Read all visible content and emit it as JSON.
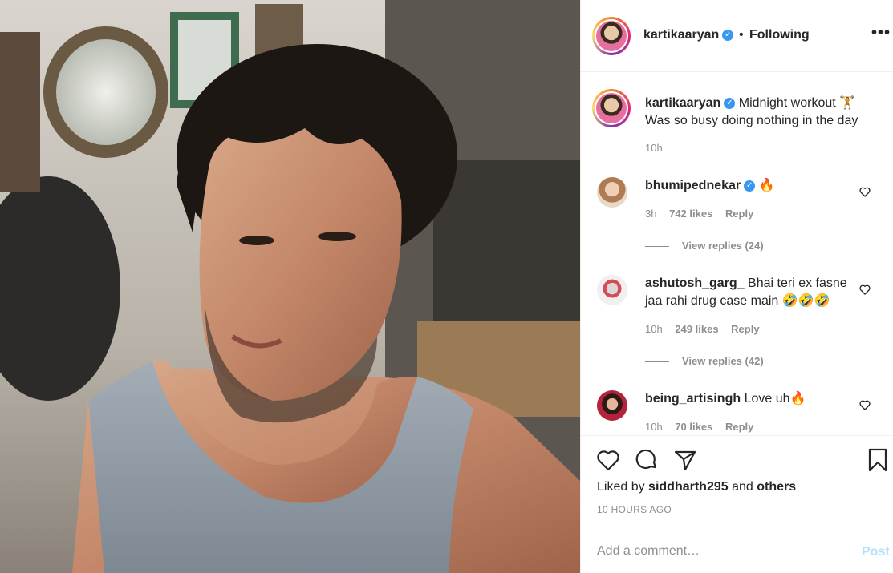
{
  "post": {
    "username": "kartikaaryan",
    "separator": "•",
    "follow_status": "Following",
    "more_label": "•••"
  },
  "caption": {
    "username": "kartikaaryan",
    "text": "Midnight workout 🏋",
    "text_line2": "Was so busy doing nothing in the day",
    "time": "10h"
  },
  "comments": [
    {
      "username": "bhumipednekar",
      "verified": true,
      "text": "🔥",
      "time": "3h",
      "likes": "742 likes",
      "reply": "Reply",
      "view_replies": "View replies (24)"
    },
    {
      "username": "ashutosh_garg_",
      "verified": false,
      "text": "Bhai teri ex fasne jaa rahi drug case main 🤣🤣🤣",
      "time": "10h",
      "likes": "249 likes",
      "reply": "Reply",
      "view_replies": "View replies (42)"
    },
    {
      "username": "being_artisingh",
      "verified": false,
      "text": "Love uh🔥",
      "time": "10h",
      "likes": "70 likes",
      "reply": "Reply"
    }
  ],
  "actions": {
    "liked_by_prefix": "Liked by",
    "liked_by_user": "siddharth295",
    "liked_by_and": "and",
    "liked_by_others": "others",
    "timestamp": "10 HOURS AGO"
  },
  "add_comment": {
    "placeholder": "Add a comment…",
    "post_label": "Post"
  }
}
